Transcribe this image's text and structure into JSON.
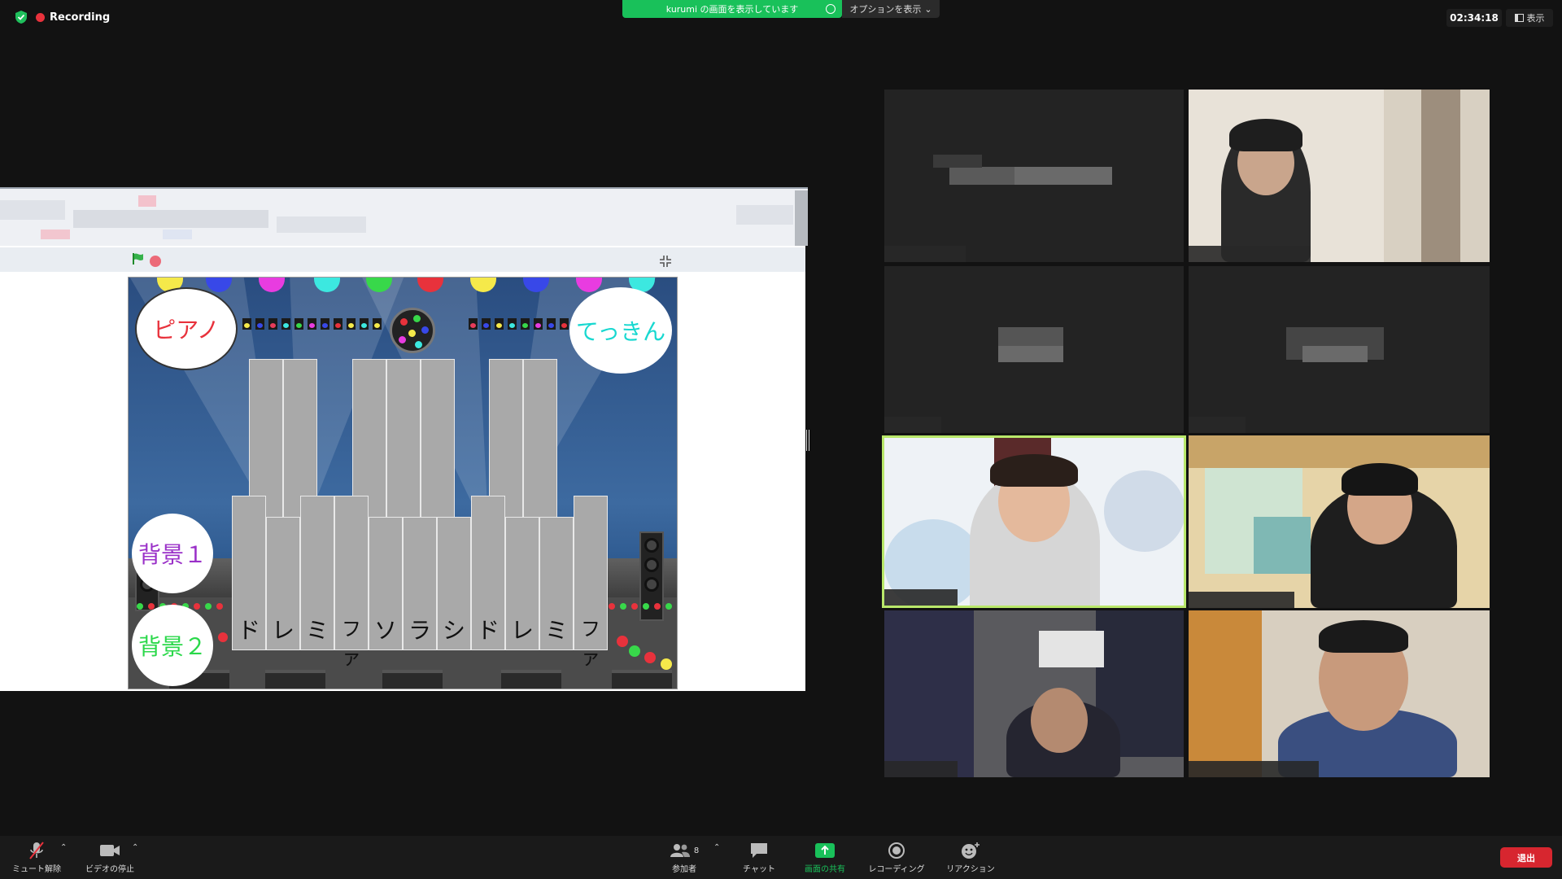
{
  "topbar": {
    "recording_label": "Recording",
    "share_banner": "kurumi の画面を表示しています",
    "options_label": "オプションを表示",
    "timer": "02:34:18",
    "view_label": "表示"
  },
  "stage": {
    "bubbles": {
      "piano": "ピアノ",
      "tekkin": "てっきん",
      "bg1": "背景１",
      "bg2": "背景２"
    },
    "keys": [
      "ド",
      "レ",
      "ミ",
      "ファ",
      "ソ",
      "ラ",
      "シ",
      "ド",
      "レ",
      "ミ",
      "ファ"
    ]
  },
  "toolbar": {
    "unmute": "ミュート解除",
    "stop_video": "ビデオの停止",
    "participants": "参加者",
    "participant_count": "8",
    "chat": "チャット",
    "share_screen": "画面の共有",
    "recording": "レコーディング",
    "reactions": "リアクション",
    "leave": "退出"
  },
  "colors": {
    "share_green": "#19c15a",
    "leave_red": "#d7262f",
    "active_speaker": "#b9e86a",
    "recording_red": "#e8323c"
  }
}
